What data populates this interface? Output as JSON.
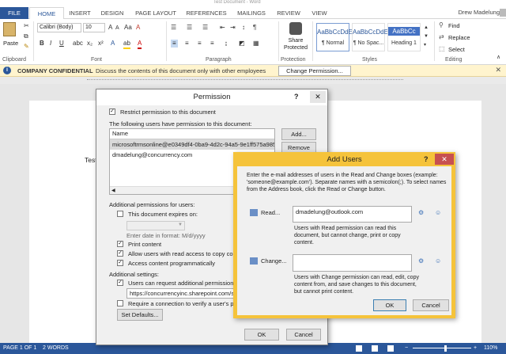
{
  "titlebar": {
    "title": "Test Document - Word"
  },
  "tabs": [
    "FILE",
    "HOME",
    "INSERT",
    "DESIGN",
    "PAGE LAYOUT",
    "REFERENCES",
    "MAILINGS",
    "REVIEW",
    "VIEW"
  ],
  "user": "Drew Madelung",
  "ribbon": {
    "paste_label": "Paste",
    "font_name": "Calibri (Body)",
    "font_size": "10",
    "group_labels": {
      "clipboard": "Clipboard",
      "font": "Font",
      "paragraph": "Paragraph",
      "protection": "Protection",
      "styles": "Styles",
      "editing": "Editing"
    },
    "share_protected": "Share Protected",
    "styles": [
      {
        "sample": "AaBbCcDdE",
        "name": "¶ Normal"
      },
      {
        "sample": "AaBbCcDdE",
        "name": "¶ No Spac..."
      },
      {
        "sample": "AaBbCc",
        "name": "Heading 1"
      }
    ],
    "find": "Find",
    "replace": "Replace",
    "select": "Select"
  },
  "infobar": {
    "title": "COMPANY CONFIDENTIAL",
    "message": "Discuss the contents of this document only with other employees",
    "button": "Change Permission..."
  },
  "doc": {
    "text": "Test"
  },
  "status": {
    "page": "PAGE 1 OF 1",
    "words": "2 WORDS",
    "zoom": "110%"
  },
  "permission": {
    "title": "Permission",
    "restrict": "Restrict permission to this document",
    "users_label": "The following users have permission to this document:",
    "col_name": "Name",
    "users": [
      "microsoftrmsonline@e0349df4-0ba9-4d2c-94a5-9e1ff575a985.rm",
      "dmadelung@concurrency.com"
    ],
    "add": "Add...",
    "remove": "Remove",
    "additional": "Additional permissions for users:",
    "expires": "This document expires on:",
    "date_hint": "Enter date in format: M/d/yyyy",
    "print": "Print content",
    "copy": "Allow users with read access to copy cont",
    "programmatic": "Access content programmatically",
    "settings": "Additional settings:",
    "request": "Users can request additional permissions",
    "request_url": "https://concurrencyinc.sharepoint.com/sit",
    "require": "Require a connection to verify a user's pe",
    "set_defaults": "Set Defaults...",
    "ok": "OK",
    "cancel": "Cancel"
  },
  "add_users": {
    "title": "Add Users",
    "instructions": "Enter the e-mail addresses of users in the Read and Change boxes (example: 'someone@example.com'). Separate names with a semicolon(;). To select names from the Address book, click the Read or Change button.",
    "read": "Read...",
    "read_value": "dmadelung@outlook.com",
    "read_desc": "Users with Read permission can read this document, but cannot change, print or copy content.",
    "change": "Change...",
    "change_value": "",
    "change_desc": "Users with Change permission can read, edit, copy content from, and save changes to this document, but cannot print content.",
    "ok": "OK",
    "cancel": "Cancel"
  },
  "colors": {
    "accent": "#2b579a",
    "highlight": "#f5c33b"
  }
}
